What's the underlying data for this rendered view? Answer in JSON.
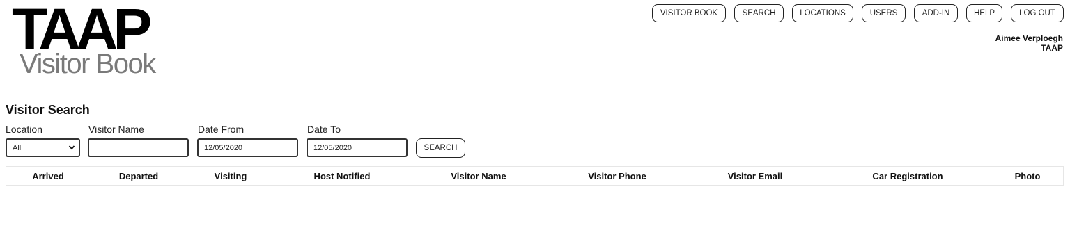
{
  "logo": {
    "main": "TAAP",
    "sub": "Visitor Book"
  },
  "topnav": {
    "visitor_book": "VISITOR BOOK",
    "search": "SEARCH",
    "locations": "LOCATIONS",
    "users": "USERS",
    "add_in": "ADD-IN",
    "help": "HELP",
    "log_out": "LOG OUT"
  },
  "user": {
    "name": "Aimee Verploegh",
    "org": "TAAP"
  },
  "search_form": {
    "title": "Visitor Search",
    "location_label": "Location",
    "location_value": "All",
    "visitor_name_label": "Visitor Name",
    "visitor_name_value": "",
    "date_from_label": "Date From",
    "date_from_value": "12/05/2020",
    "date_to_label": "Date To",
    "date_to_value": "12/05/2020",
    "search_button": "SEARCH"
  },
  "results": {
    "columns": [
      "Arrived",
      "Departed",
      "Visiting",
      "Host Notified",
      "Visitor Name",
      "Visitor Phone",
      "Visitor Email",
      "Car Registration",
      "Photo"
    ],
    "rows": []
  }
}
